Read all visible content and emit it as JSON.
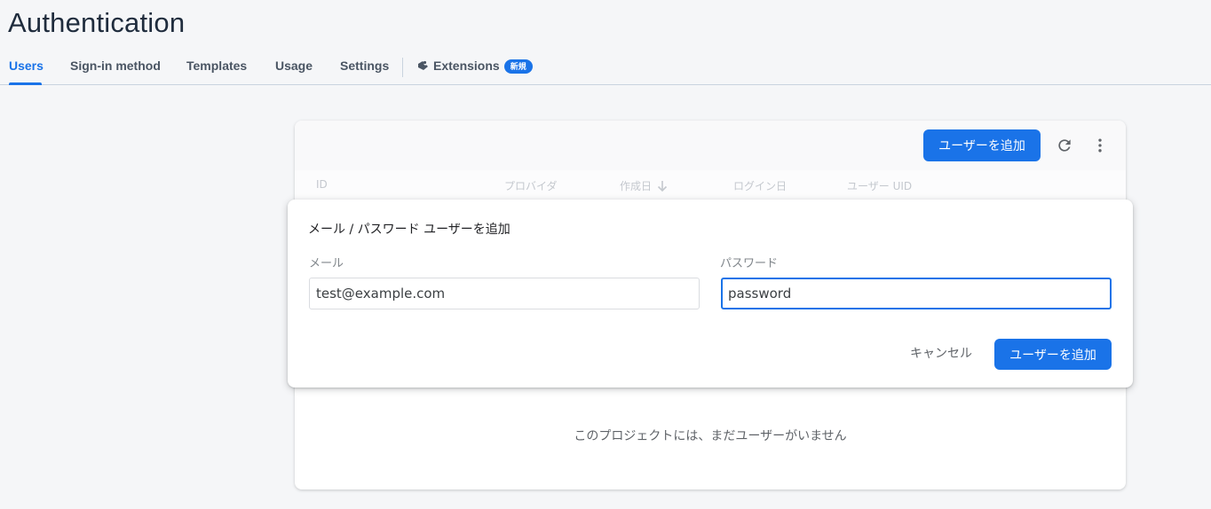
{
  "header": {
    "title": "Authentication"
  },
  "tabs": [
    {
      "label": "Users",
      "active": true
    },
    {
      "label": "Sign-in method",
      "active": false
    },
    {
      "label": "Templates",
      "active": false
    },
    {
      "label": "Usage",
      "active": false
    },
    {
      "label": "Settings",
      "active": false
    },
    {
      "label": "Extensions",
      "active": false,
      "badge": "新規",
      "icon": "extensions-icon"
    }
  ],
  "users_card": {
    "add_button_label": "ユーザーを追加",
    "refresh_icon": "refresh-icon",
    "more_icon": "more-vert-icon",
    "columns": [
      {
        "label": "ID"
      },
      {
        "label": "プロバイダ"
      },
      {
        "label": "作成日",
        "sort": "descending"
      },
      {
        "label": "ログイン日"
      },
      {
        "label": "ユーザー UID"
      }
    ],
    "empty_message": "このプロジェクトには、まだユーザーがいません"
  },
  "dialog": {
    "title": "メール / パスワード ユーザーを追加",
    "email_label": "メール",
    "email_value": "test@example.com",
    "password_label": "パスワード",
    "password_value": "password",
    "cancel_label": "キャンセル",
    "add_label": "ユーザーを追加"
  },
  "colors": {
    "primary": "#1a73e8",
    "background": "#f5f6f8",
    "title_text": "#1f2c3d"
  }
}
